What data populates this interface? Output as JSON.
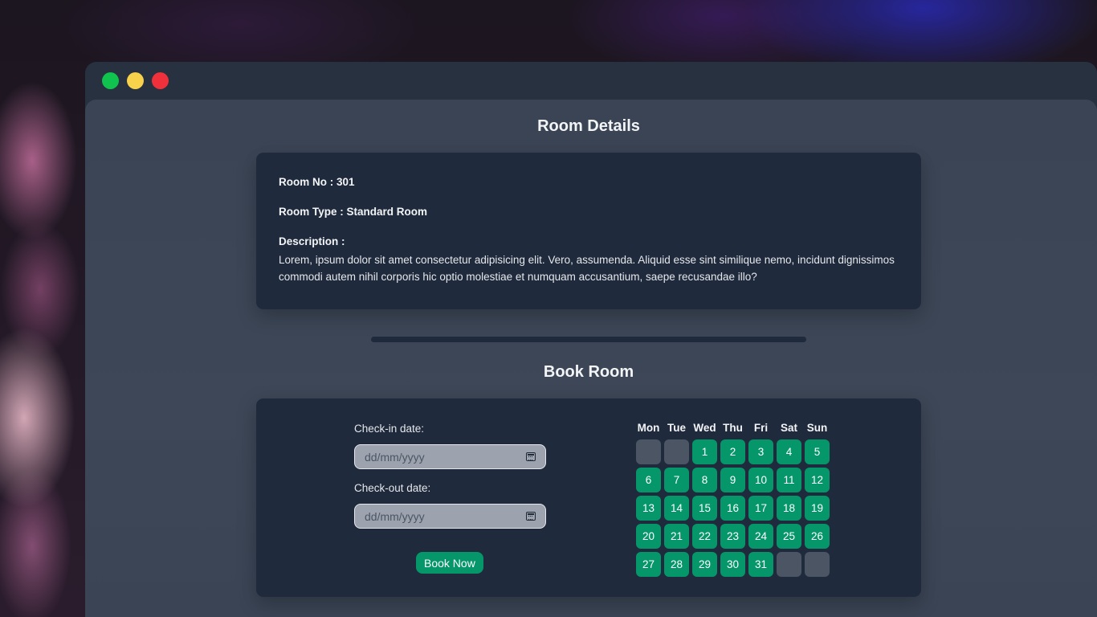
{
  "window": {
    "controls": [
      "green",
      "yellow",
      "red"
    ]
  },
  "details": {
    "title": "Room Details",
    "room_no": "Room No : 301",
    "room_type": "Room Type : Standard Room",
    "description_label": "Description :",
    "description": "Lorem, ipsum dolor sit amet consectetur adipisicing elit. Vero, assumenda. Aliquid esse sint similique nemo, incidunt dignissimos commodi autem nihil corporis hic optio molestiae et numquam accusantium, saepe recusandae illo?"
  },
  "booking": {
    "title": "Book Room",
    "checkin_label": "Check-in date:",
    "checkin_placeholder": "dd/mm/yyyy",
    "checkout_label": "Check-out date:",
    "checkout_placeholder": "dd/mm/yyyy",
    "book_button": "Book Now"
  },
  "calendar": {
    "weekdays": [
      "Mon",
      "Tue",
      "Wed",
      "Thu",
      "Fri",
      "Sat",
      "Sun"
    ],
    "leading_blanks": 2,
    "days": 31,
    "trailing_blanks": 2
  },
  "colors": {
    "accent": "#059669",
    "card": "#1f2a3c",
    "empty_day": "#4b5563"
  }
}
